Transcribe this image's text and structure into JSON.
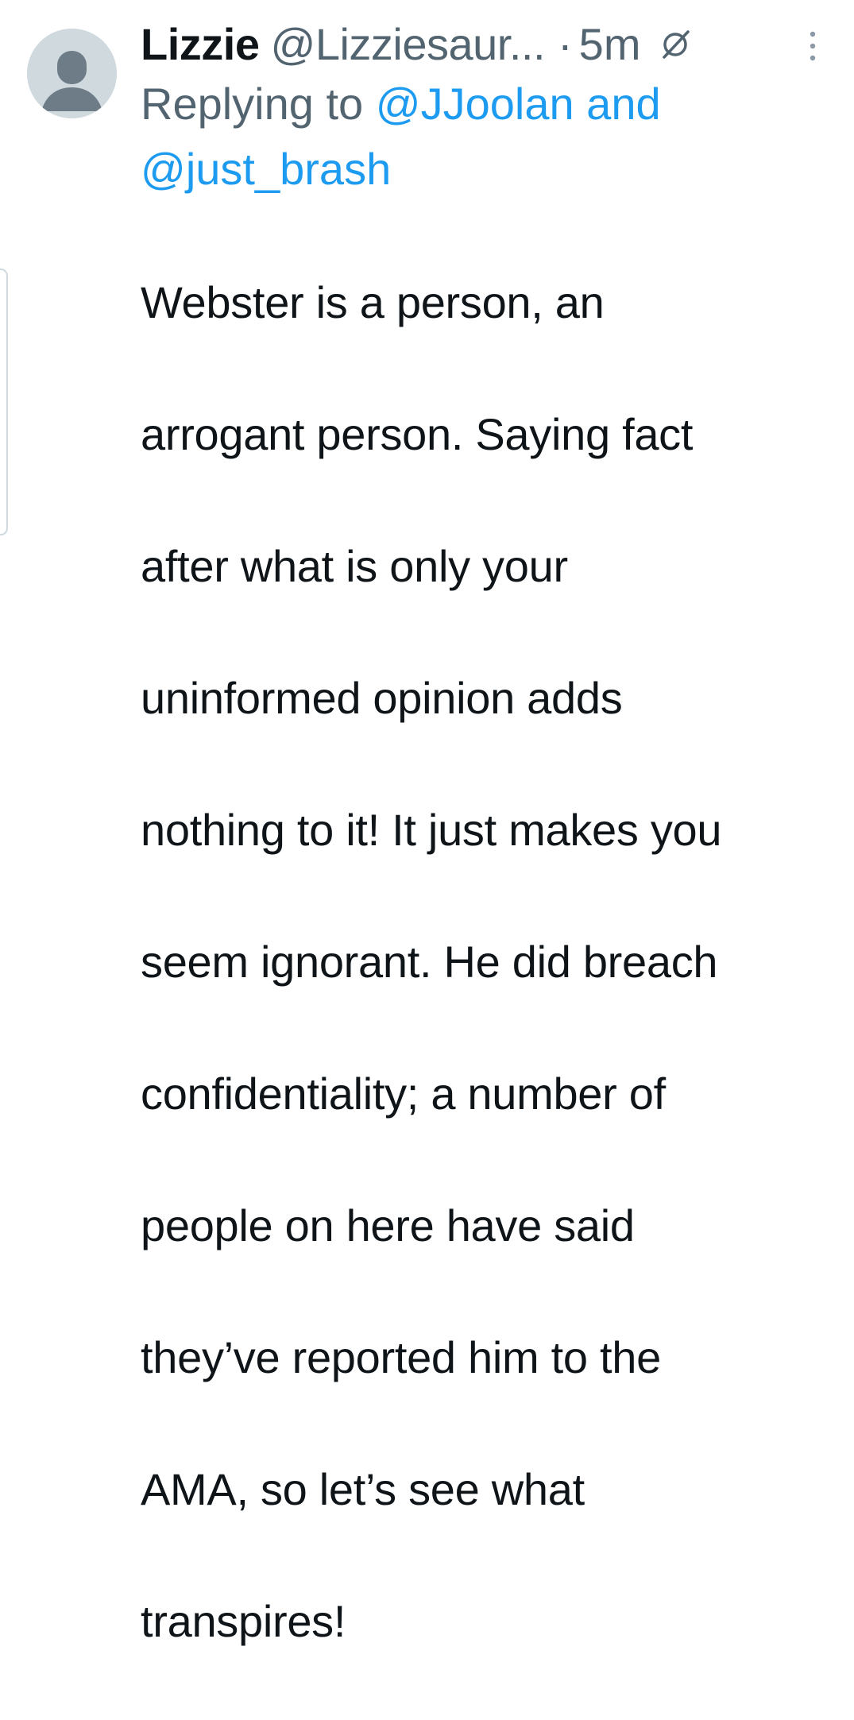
{
  "tweet": {
    "author": {
      "display_name": "Lizzie",
      "handle": "@Lizziesaur...",
      "avatar_icon": "default-avatar-icon"
    },
    "separator": "·",
    "timestamp": "5m",
    "edit_icon": "edited-indicator-icon",
    "more_icon": "more-options-icon",
    "reply": {
      "prefix": "Replying to",
      "mention_1": "@JJoolan",
      "conjunction": "and",
      "mention_2": "@just_brash"
    },
    "text_lines": [
      "Webster is a person, an",
      "arrogant person. Saying fact",
      "after what is only your",
      "uninformed opinion adds",
      "nothing to it! It just makes you",
      "seem ignorant. He did breach",
      "confidentiality; a number of",
      "people on here have said",
      "they’ve reported him to the",
      "AMA, so let’s see what",
      "transpires!"
    ]
  },
  "colors": {
    "text_primary": "#0f1419",
    "text_secondary": "#536471",
    "link": "#1d9bf0",
    "avatar_bg": "#cfd9de",
    "avatar_fg": "#6e7c87"
  }
}
